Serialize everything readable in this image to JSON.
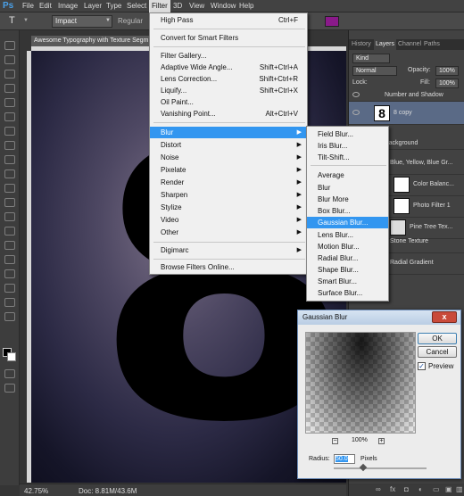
{
  "app": {
    "logo": "Ps"
  },
  "menubar": {
    "items": [
      "File",
      "Edit",
      "Image",
      "Layer",
      "Type",
      "Select",
      "Filter",
      "3D",
      "View",
      "Window",
      "Help"
    ]
  },
  "options_bar": {
    "font": "Impact",
    "style": "Regular",
    "tool_glyph": "T"
  },
  "document": {
    "tab_title": "Awesome Typography with Texture Segm",
    "zoom": "42.75%",
    "doc_size": "Doc: 8.81M/43.6M",
    "canvas_glyph": "8"
  },
  "filter_menu": {
    "items": [
      {
        "label": "High Pass",
        "shortcut": "Ctrl+F"
      },
      {
        "label": "Convert for Smart Filters",
        "shortcut": ""
      },
      {
        "label": "Filter Gallery...",
        "shortcut": ""
      },
      {
        "label": "Adaptive Wide Angle...",
        "shortcut": "Shift+Ctrl+A"
      },
      {
        "label": "Lens Correction...",
        "shortcut": "Shift+Ctrl+R"
      },
      {
        "label": "Liquify...",
        "shortcut": "Shift+Ctrl+X"
      },
      {
        "label": "Oil Paint...",
        "shortcut": ""
      },
      {
        "label": "Vanishing Point...",
        "shortcut": "Alt+Ctrl+V"
      },
      {
        "label": "Blur",
        "submenu": true
      },
      {
        "label": "Distort",
        "submenu": true
      },
      {
        "label": "Noise",
        "submenu": true
      },
      {
        "label": "Pixelate",
        "submenu": true
      },
      {
        "label": "Render",
        "submenu": true
      },
      {
        "label": "Sharpen",
        "submenu": true
      },
      {
        "label": "Stylize",
        "submenu": true
      },
      {
        "label": "Video",
        "submenu": true
      },
      {
        "label": "Other",
        "submenu": true
      },
      {
        "label": "Digimarc",
        "submenu": true
      },
      {
        "label": "Browse Filters Online...",
        "shortcut": ""
      }
    ]
  },
  "blur_submenu": {
    "items": [
      "Field Blur...",
      "Iris Blur...",
      "Tilt-Shift...",
      "Average",
      "Blur",
      "Blur More",
      "Box Blur...",
      "Gaussian Blur...",
      "Lens Blur...",
      "Motion Blur...",
      "Radial Blur...",
      "Shape Blur...",
      "Smart Blur...",
      "Surface Blur..."
    ],
    "selected": "Gaussian Blur..."
  },
  "layers_panel": {
    "tabs": [
      "History",
      "Layers",
      "Channel",
      "Paths"
    ],
    "active_tab": "Layers",
    "kind": "Kind",
    "blend_mode": "Normal",
    "opacity_label": "Opacity:",
    "opacity_value": "100%",
    "lock_label": "Lock:",
    "fill_label": "Fill:",
    "fill_value": "100%",
    "layers": [
      {
        "name": "Number and Shadow"
      },
      {
        "name": "8 copy",
        "thumb": "8"
      },
      {
        "name": "Background"
      },
      {
        "name": "Blue, Yellow, Blue Gr..."
      },
      {
        "name": "Color Balanc..."
      },
      {
        "name": "Photo Filter 1"
      },
      {
        "name": "Pine Tree Tex..."
      },
      {
        "name": "Stone Texture"
      },
      {
        "name": "Radial Gradient"
      }
    ]
  },
  "gaussian_dialog": {
    "title": "Gaussian Blur",
    "close_label": "x",
    "ok_label": "OK",
    "cancel_label": "Cancel",
    "preview_label": "Preview",
    "preview_checked": true,
    "zoom_level": "100%",
    "zoom_minus": "−",
    "zoom_plus": "+",
    "radius_label": "Radius:",
    "radius_value": "50.0",
    "radius_unit": "Pixels"
  },
  "colors": {
    "menu_highlight": "#3296f0",
    "swatch": "#8a1a8a"
  }
}
